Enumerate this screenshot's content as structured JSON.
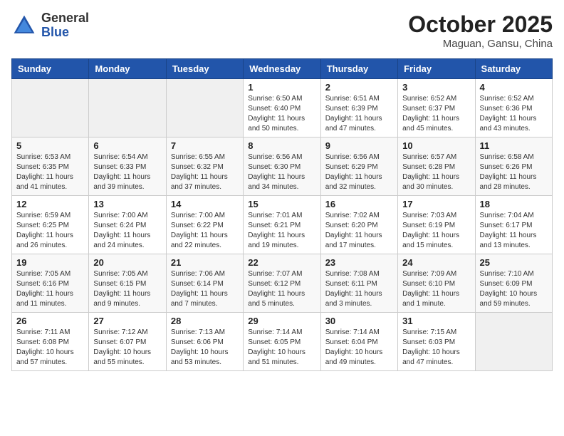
{
  "header": {
    "logo_general": "General",
    "logo_blue": "Blue",
    "month": "October 2025",
    "location": "Maguan, Gansu, China"
  },
  "weekdays": [
    "Sunday",
    "Monday",
    "Tuesday",
    "Wednesday",
    "Thursday",
    "Friday",
    "Saturday"
  ],
  "weeks": [
    [
      {
        "day": "",
        "info": ""
      },
      {
        "day": "",
        "info": ""
      },
      {
        "day": "",
        "info": ""
      },
      {
        "day": "1",
        "info": "Sunrise: 6:50 AM\nSunset: 6:40 PM\nDaylight: 11 hours\nand 50 minutes."
      },
      {
        "day": "2",
        "info": "Sunrise: 6:51 AM\nSunset: 6:39 PM\nDaylight: 11 hours\nand 47 minutes."
      },
      {
        "day": "3",
        "info": "Sunrise: 6:52 AM\nSunset: 6:37 PM\nDaylight: 11 hours\nand 45 minutes."
      },
      {
        "day": "4",
        "info": "Sunrise: 6:52 AM\nSunset: 6:36 PM\nDaylight: 11 hours\nand 43 minutes."
      }
    ],
    [
      {
        "day": "5",
        "info": "Sunrise: 6:53 AM\nSunset: 6:35 PM\nDaylight: 11 hours\nand 41 minutes."
      },
      {
        "day": "6",
        "info": "Sunrise: 6:54 AM\nSunset: 6:33 PM\nDaylight: 11 hours\nand 39 minutes."
      },
      {
        "day": "7",
        "info": "Sunrise: 6:55 AM\nSunset: 6:32 PM\nDaylight: 11 hours\nand 37 minutes."
      },
      {
        "day": "8",
        "info": "Sunrise: 6:56 AM\nSunset: 6:30 PM\nDaylight: 11 hours\nand 34 minutes."
      },
      {
        "day": "9",
        "info": "Sunrise: 6:56 AM\nSunset: 6:29 PM\nDaylight: 11 hours\nand 32 minutes."
      },
      {
        "day": "10",
        "info": "Sunrise: 6:57 AM\nSunset: 6:28 PM\nDaylight: 11 hours\nand 30 minutes."
      },
      {
        "day": "11",
        "info": "Sunrise: 6:58 AM\nSunset: 6:26 PM\nDaylight: 11 hours\nand 28 minutes."
      }
    ],
    [
      {
        "day": "12",
        "info": "Sunrise: 6:59 AM\nSunset: 6:25 PM\nDaylight: 11 hours\nand 26 minutes."
      },
      {
        "day": "13",
        "info": "Sunrise: 7:00 AM\nSunset: 6:24 PM\nDaylight: 11 hours\nand 24 minutes."
      },
      {
        "day": "14",
        "info": "Sunrise: 7:00 AM\nSunset: 6:22 PM\nDaylight: 11 hours\nand 22 minutes."
      },
      {
        "day": "15",
        "info": "Sunrise: 7:01 AM\nSunset: 6:21 PM\nDaylight: 11 hours\nand 19 minutes."
      },
      {
        "day": "16",
        "info": "Sunrise: 7:02 AM\nSunset: 6:20 PM\nDaylight: 11 hours\nand 17 minutes."
      },
      {
        "day": "17",
        "info": "Sunrise: 7:03 AM\nSunset: 6:19 PM\nDaylight: 11 hours\nand 15 minutes."
      },
      {
        "day": "18",
        "info": "Sunrise: 7:04 AM\nSunset: 6:17 PM\nDaylight: 11 hours\nand 13 minutes."
      }
    ],
    [
      {
        "day": "19",
        "info": "Sunrise: 7:05 AM\nSunset: 6:16 PM\nDaylight: 11 hours\nand 11 minutes."
      },
      {
        "day": "20",
        "info": "Sunrise: 7:05 AM\nSunset: 6:15 PM\nDaylight: 11 hours\nand 9 minutes."
      },
      {
        "day": "21",
        "info": "Sunrise: 7:06 AM\nSunset: 6:14 PM\nDaylight: 11 hours\nand 7 minutes."
      },
      {
        "day": "22",
        "info": "Sunrise: 7:07 AM\nSunset: 6:12 PM\nDaylight: 11 hours\nand 5 minutes."
      },
      {
        "day": "23",
        "info": "Sunrise: 7:08 AM\nSunset: 6:11 PM\nDaylight: 11 hours\nand 3 minutes."
      },
      {
        "day": "24",
        "info": "Sunrise: 7:09 AM\nSunset: 6:10 PM\nDaylight: 11 hours\nand 1 minute."
      },
      {
        "day": "25",
        "info": "Sunrise: 7:10 AM\nSunset: 6:09 PM\nDaylight: 10 hours\nand 59 minutes."
      }
    ],
    [
      {
        "day": "26",
        "info": "Sunrise: 7:11 AM\nSunset: 6:08 PM\nDaylight: 10 hours\nand 57 minutes."
      },
      {
        "day": "27",
        "info": "Sunrise: 7:12 AM\nSunset: 6:07 PM\nDaylight: 10 hours\nand 55 minutes."
      },
      {
        "day": "28",
        "info": "Sunrise: 7:13 AM\nSunset: 6:06 PM\nDaylight: 10 hours\nand 53 minutes."
      },
      {
        "day": "29",
        "info": "Sunrise: 7:14 AM\nSunset: 6:05 PM\nDaylight: 10 hours\nand 51 minutes."
      },
      {
        "day": "30",
        "info": "Sunrise: 7:14 AM\nSunset: 6:04 PM\nDaylight: 10 hours\nand 49 minutes."
      },
      {
        "day": "31",
        "info": "Sunrise: 7:15 AM\nSunset: 6:03 PM\nDaylight: 10 hours\nand 47 minutes."
      },
      {
        "day": "",
        "info": ""
      }
    ]
  ]
}
